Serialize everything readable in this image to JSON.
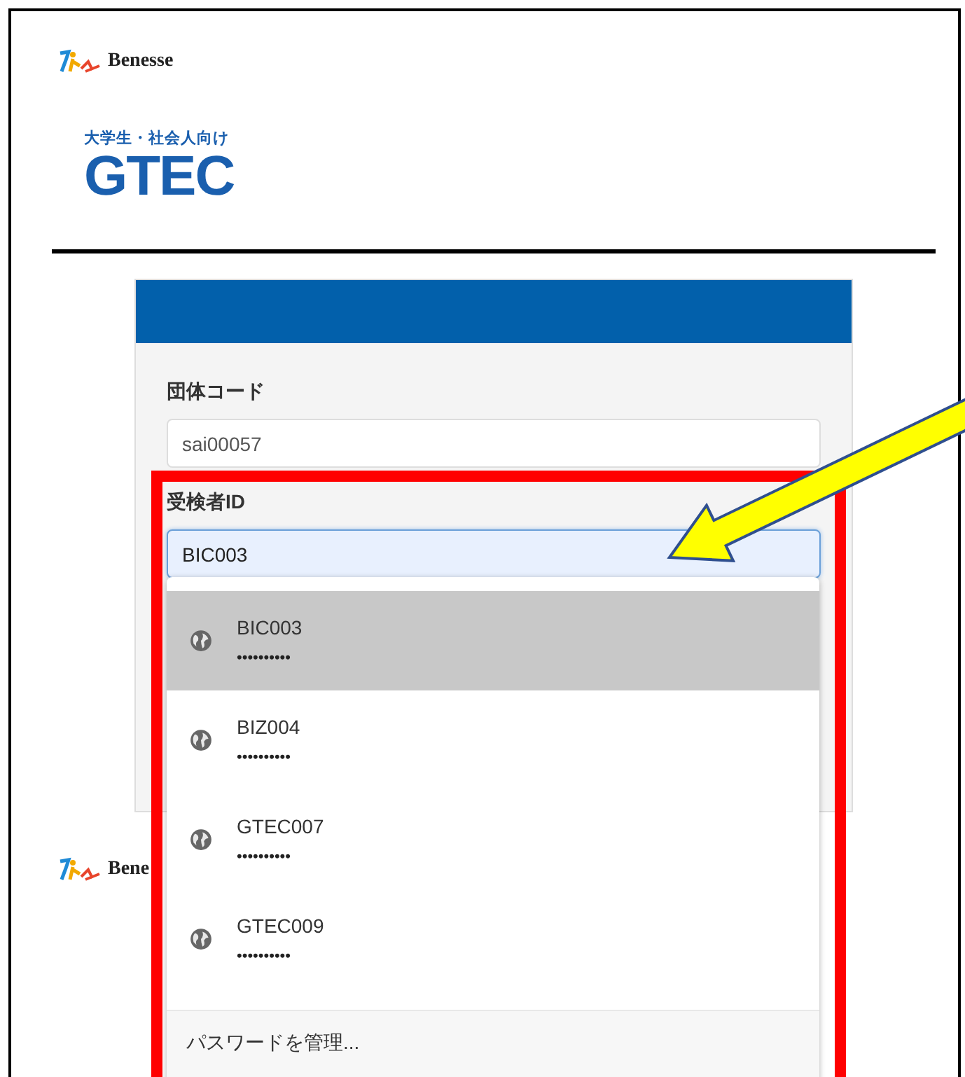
{
  "header": {
    "brand": "Benesse",
    "subtitle": "大学生・社会人向け",
    "product": "GTEC"
  },
  "form": {
    "fields": [
      {
        "label": "団体コード",
        "value": "sai00057",
        "focused": false
      },
      {
        "label": "受検者ID",
        "value": "BIC003",
        "focused": true
      }
    ]
  },
  "autofill": {
    "items": [
      {
        "username": "BIC003",
        "password": "••••••••••",
        "selected": true
      },
      {
        "username": "BIZ004",
        "password": "••••••••••",
        "selected": false
      },
      {
        "username": "GTEC007",
        "password": "••••••••••",
        "selected": false
      },
      {
        "username": "GTEC009",
        "password": "••••••••••",
        "selected": false
      }
    ],
    "footer": "パスワードを管理..."
  },
  "footer": {
    "brand": "Bene"
  }
}
